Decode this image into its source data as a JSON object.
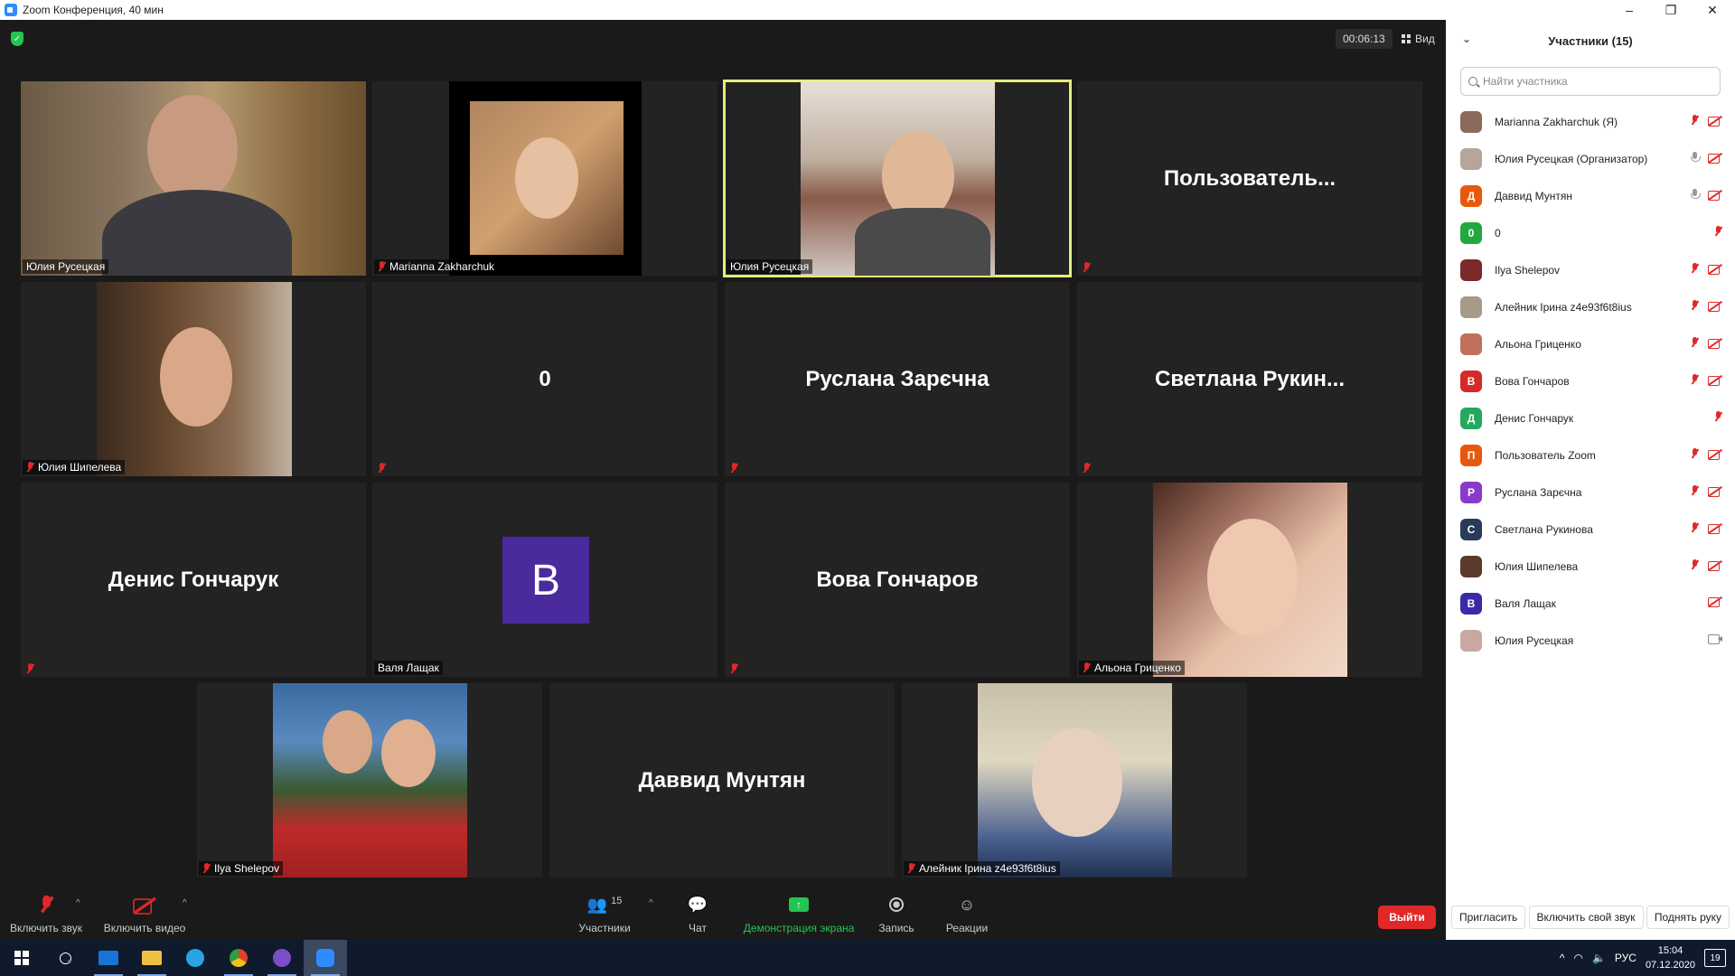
{
  "window": {
    "title": "Zoom Конференция, 40 мин"
  },
  "meeting": {
    "timer": "00:06:13",
    "view_label": "Вид"
  },
  "tiles": [
    {
      "name": "Юлия Русецкая",
      "label": "Юлия Русецкая",
      "muted": false,
      "video": true
    },
    {
      "name": "Marianna Zakharchuk",
      "label": "Marianna Zakharchuk",
      "muted": true,
      "video": true
    },
    {
      "name": "Юлия Русецкая",
      "label": "Юлия Русецкая",
      "muted": false,
      "video": true,
      "active_speaker": true
    },
    {
      "name": "Пользователь...",
      "label": "",
      "muted": true,
      "video": false
    },
    {
      "name": "Юлия Шипелева",
      "label": "Юлия Шипелева",
      "muted": true,
      "video": true
    },
    {
      "name": "0",
      "label": "",
      "muted": true,
      "video": false
    },
    {
      "name": "Руслана Зарєчна",
      "label": "",
      "muted": true,
      "video": false
    },
    {
      "name": "Светлана  Рукин...",
      "label": "",
      "muted": true,
      "video": false
    },
    {
      "name": "Денис Гончарук",
      "label": "",
      "muted": true,
      "video": false
    },
    {
      "name": "В",
      "label": "Валя Лащак",
      "muted": false,
      "video": false,
      "avatar": true
    },
    {
      "name": "Вова Гончаров",
      "label": "",
      "muted": true,
      "video": false
    },
    {
      "name": "Альона Гриценко",
      "label": "Альона Гриценко",
      "muted": true,
      "video": true
    },
    {
      "name": "Ilya Shelepov",
      "label": "Ilya Shelepov",
      "muted": true,
      "video": true
    },
    {
      "name": "Даввид Мунтян",
      "label": "",
      "muted": false,
      "video": false
    },
    {
      "name": "Алейник Ірина z4e93f6t8ius",
      "label": "Алейник Ірина z4e93f6t8ius",
      "muted": true,
      "video": true
    }
  ],
  "toolbar": {
    "unmute": "Включить звук",
    "start_video": "Включить видео",
    "participants": "Участники",
    "participants_count": "15",
    "chat": "Чат",
    "share": "Демонстрация экрана",
    "record": "Запись",
    "reactions": "Реакции",
    "leave": "Выйти"
  },
  "panel": {
    "title": "Участники (15)",
    "search_placeholder": "Найти участника",
    "participants": [
      {
        "name": "Marianna Zakharchuk (Я)",
        "initial": "",
        "color": "#8a6a5a",
        "mic": "off",
        "cam": "off"
      },
      {
        "name": "Юлия Русецкая (Организатор)",
        "initial": "",
        "color": "#b7a49a",
        "mic": "on",
        "cam": "off"
      },
      {
        "name": "Даввид Мунтян",
        "initial": "Д",
        "color": "#e8580c",
        "mic": "on",
        "cam": "off"
      },
      {
        "name": "0",
        "initial": "0",
        "color": "#23a840",
        "mic": "off",
        "cam": "none"
      },
      {
        "name": "Ilya Shelepov",
        "initial": "",
        "color": "#7a2a2a",
        "mic": "off",
        "cam": "off"
      },
      {
        "name": "Алейник Ірина z4e93f6t8ius",
        "initial": "",
        "color": "#a89a88",
        "mic": "off",
        "cam": "off"
      },
      {
        "name": "Альона Гриценко",
        "initial": "",
        "color": "#c0705a",
        "mic": "off",
        "cam": "off"
      },
      {
        "name": "Вова Гончаров",
        "initial": "В",
        "color": "#d42a2a",
        "mic": "off",
        "cam": "off"
      },
      {
        "name": "Денис Гончарук",
        "initial": "Д",
        "color": "#23a860",
        "mic": "off",
        "cam": "none"
      },
      {
        "name": "Пользователь Zoom",
        "initial": "П",
        "color": "#e8580c",
        "mic": "off",
        "cam": "off"
      },
      {
        "name": "Руслана Зарєчна",
        "initial": "Р",
        "color": "#8a3ac8",
        "mic": "off",
        "cam": "off"
      },
      {
        "name": "Светлана Рукинова",
        "initial": "С",
        "color": "#2a3a5a",
        "mic": "off",
        "cam": "off"
      },
      {
        "name": "Юлия Шипелева",
        "initial": "",
        "color": "#5a3a2a",
        "mic": "off",
        "cam": "off"
      },
      {
        "name": "Валя Лащак",
        "initial": "В",
        "color": "#3a2aa8",
        "mic": "none",
        "cam": "off"
      },
      {
        "name": "Юлия Русецкая",
        "initial": "",
        "color": "#c8a8a0",
        "mic": "none",
        "cam": "on"
      }
    ],
    "invite": "Пригласить",
    "unmute_me": "Включить свой звук",
    "raise_hand": "Поднять руку"
  },
  "taskbar": {
    "language": "РУС",
    "time": "15:04",
    "date": "07.12.2020",
    "notifications": "19"
  }
}
